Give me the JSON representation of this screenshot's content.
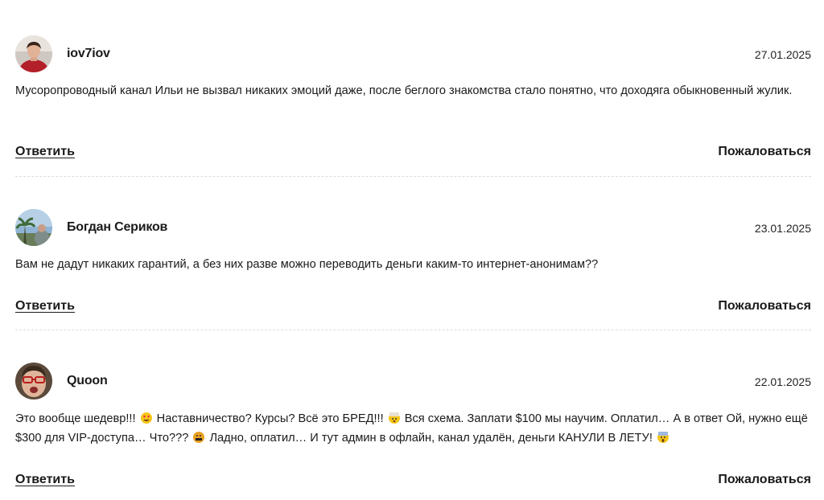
{
  "comments": [
    {
      "author": "iov7iov",
      "date": "27.01.2025",
      "text": "Мусоропроводный канал Ильи не вызвал никаких эмоций даже, после беглого знакомства стало понятно, что доходяга обыкновенный жулик.",
      "reply_label": "Ответить",
      "report_label": "Пожаловаться"
    },
    {
      "author": "Богдан Сериков",
      "date": "23.01.2025",
      "text": "Вам не дадут никаких гарантий, а без них разве можно переводить деньги каким-то интернет-анонимам??",
      "reply_label": "Ответить",
      "report_label": "Пожаловаться"
    },
    {
      "author": "Quoon",
      "date": "22.01.2025",
      "text_parts": [
        "Это вообще шедевр!!!",
        "Наставничество? Курсы? Всё это БРЕД!!!",
        "Вся схема. Заплати $100 мы научим. Оплатил… А в ответ Ой, нужно ещё $300 для VIP-доступа… Что???",
        "Ладно, оплатил… И тут админ в офлайн, канал удалён, деньги КАНУЛИ В ЛЕТУ!"
      ],
      "emojis": [
        "smiling-face-with-heart-eyes",
        "exploding-head",
        "face-with-symbols-on-mouth",
        "face-screaming-in-fear"
      ],
      "reply_label": "Ответить",
      "report_label": "Пожаловаться"
    }
  ],
  "colors": {
    "text": "#1a1a1a",
    "divider": "#dcdcdc"
  }
}
